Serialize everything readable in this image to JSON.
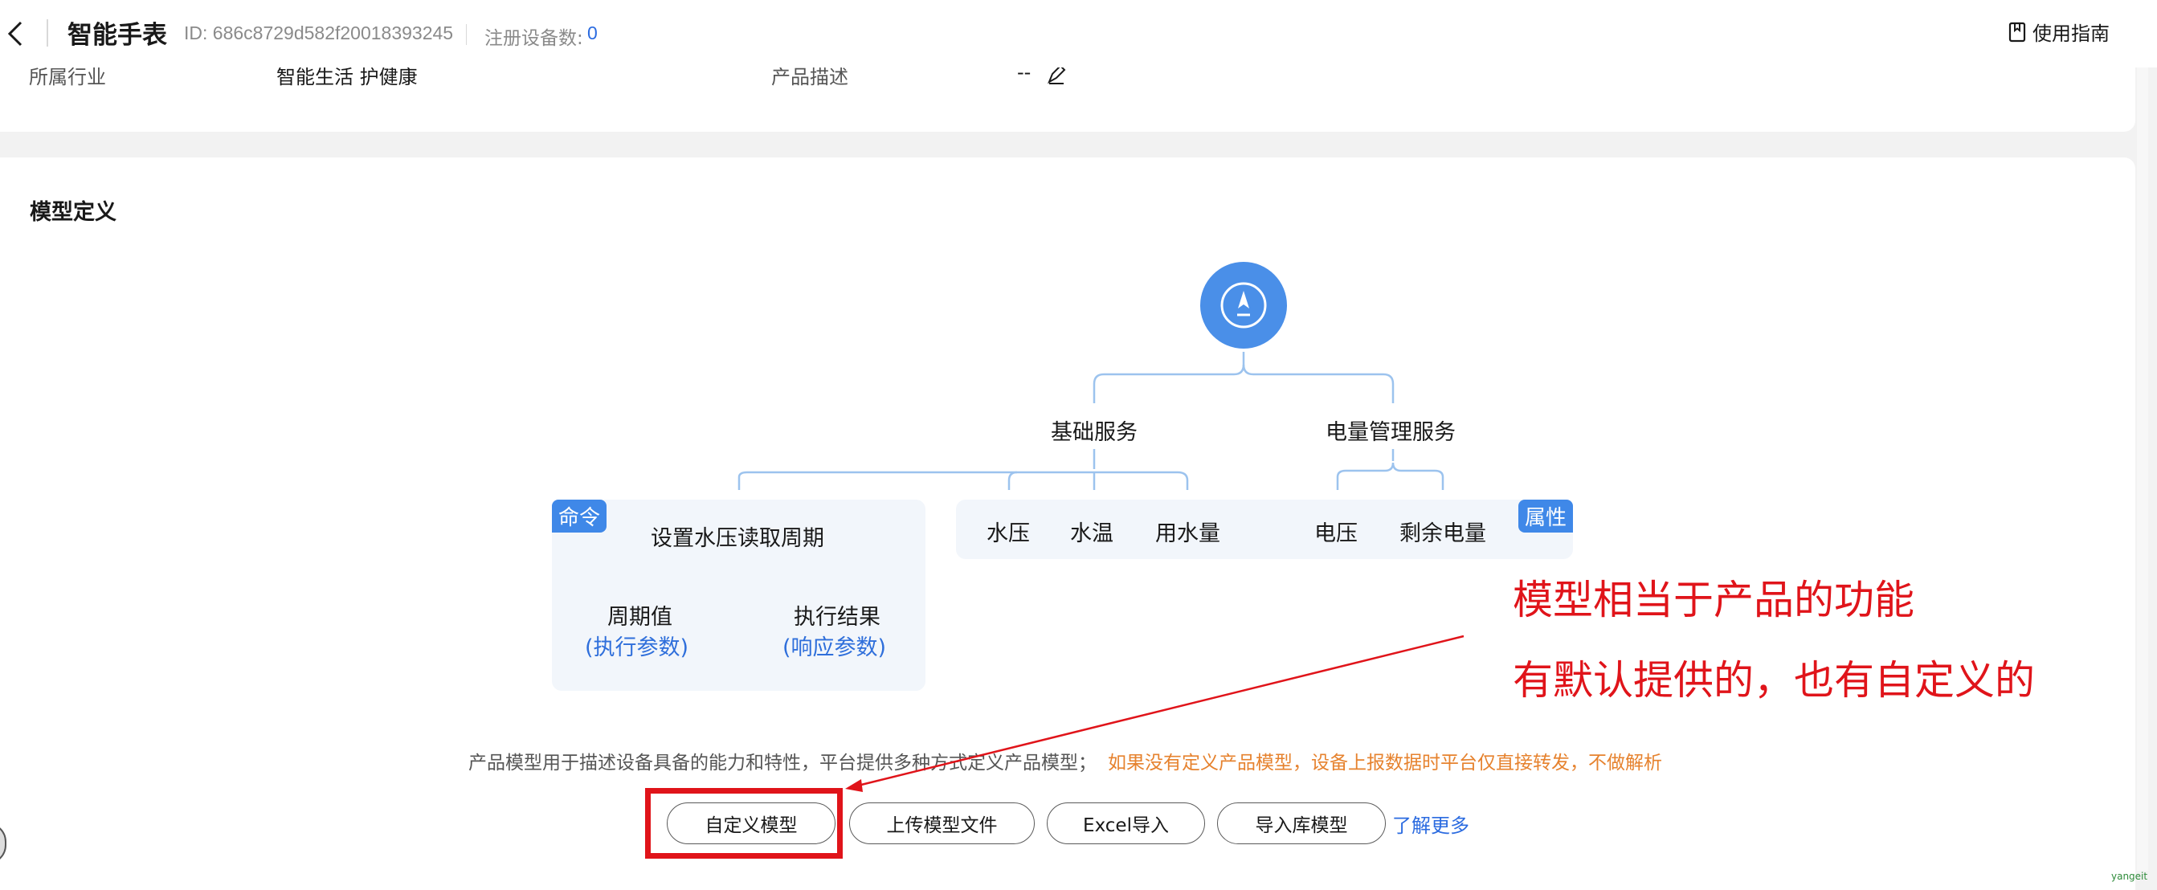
{
  "header": {
    "title": "智能手表",
    "device_id": "ID: 686c8729d582f20018393245",
    "registered_label": "注册设备数:",
    "registered_count": "0",
    "guide_label": "使用指南"
  },
  "info_row": {
    "industry_label": "所属行业",
    "industry_value": "智能生活 护健康",
    "desc_label": "产品描述",
    "desc_value": "--"
  },
  "model_section": {
    "title": "模型定义",
    "diagram": {
      "service_1": "基础服务",
      "service_2": "电量管理服务",
      "command_tag": "命令",
      "command_name": "设置水压读取周期",
      "param_name": "周期值",
      "param_type": "(执行参数)",
      "response_name": "执行结果",
      "response_type": "(响应参数)",
      "attr_tag": "属性",
      "attributes": [
        "水压",
        "水温",
        "用水量",
        "电压",
        "剩余电量"
      ]
    },
    "description": "产品模型用于描述设备具备的能力和特性，平台提供多种方式定义产品模型；",
    "warning": "如果没有定义产品模型，设备上报数据时平台仅直接转发，不做解析",
    "buttons": {
      "custom": "自定义模型",
      "upload": "上传模型文件",
      "excel": "Excel导入",
      "library": "导入库模型"
    },
    "learn_more": "了解更多"
  },
  "annotation": {
    "line1": "模型相当于产品的功能",
    "line2": "有默认提供的，也有自定义的"
  },
  "watermark": "yangeit",
  "colors": {
    "accent": "#2b6be0",
    "root_node": "#4a8fe8",
    "warning": "#e6822e",
    "annotation": "#e0141a"
  }
}
